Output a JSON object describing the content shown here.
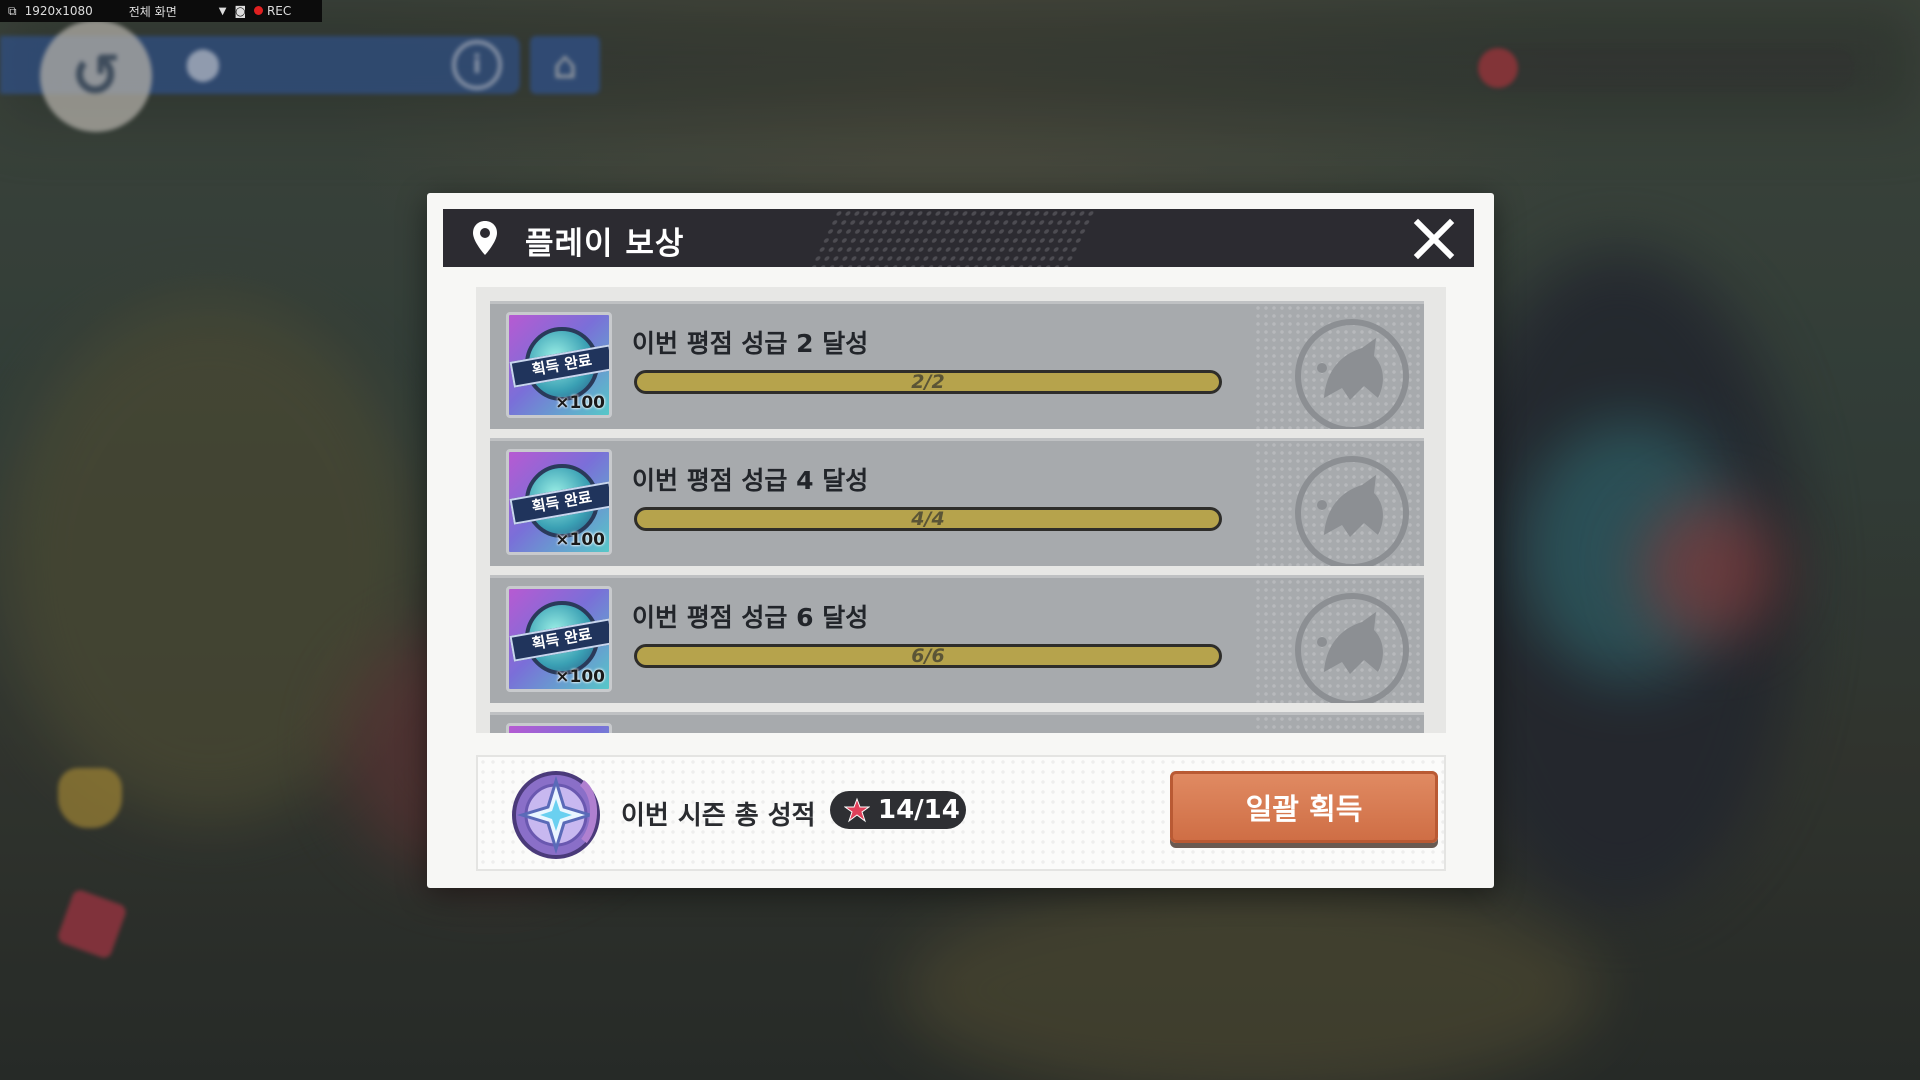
{
  "recorder": {
    "resolution": "1920x1080",
    "mode": "전체 화면",
    "rec_label": "REC"
  },
  "colors": {
    "header_bg": "#2c2b31",
    "progress_fill": "#b6a34c",
    "claim_button": "#d7774b",
    "row_bg": "#a7aaad"
  },
  "modal": {
    "title": "플레이 보상",
    "rows": [
      {
        "title": "이번 평점 성급 2 달성",
        "reward_badge": "획득 완료",
        "reward_qty": "×100",
        "progress_text": "2/2",
        "progress": 1.0
      },
      {
        "title": "이번 평점 성급 4 달성",
        "reward_badge": "획득 완료",
        "reward_qty": "×100",
        "progress_text": "4/4",
        "progress": 1.0
      },
      {
        "title": "이번 평점 성급 6 달성",
        "reward_badge": "획득 완료",
        "reward_qty": "×100",
        "progress_text": "6/6",
        "progress": 1.0
      }
    ],
    "season_label": "이번 시즌 총 성적",
    "season_score": "14/14",
    "claim_all_label": "일괄 획득"
  }
}
